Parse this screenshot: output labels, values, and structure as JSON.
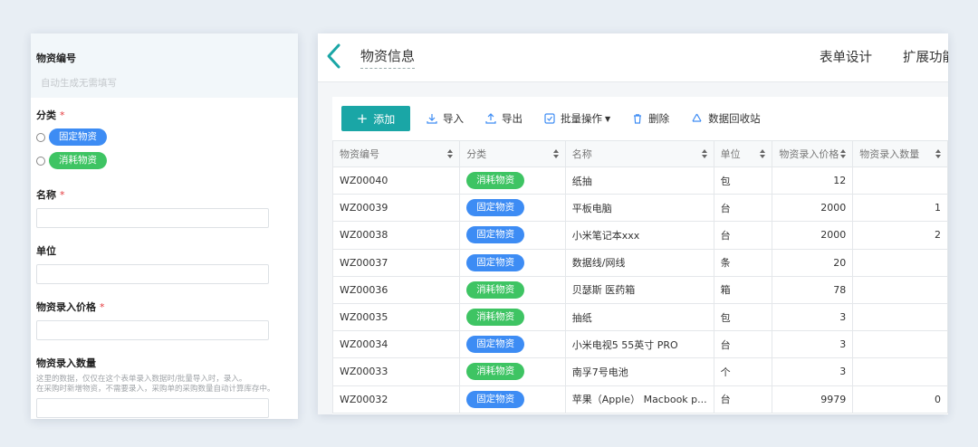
{
  "form": {
    "code_label": "物资编号",
    "code_placeholder": "自动生成无需填写",
    "category_label": "分类",
    "required_mark": "*",
    "category_options": [
      "固定物资",
      "消耗物资"
    ],
    "name_label": "名称",
    "unit_label": "单位",
    "price_label": "物资录入价格",
    "qty_label": "物资录入数量",
    "qty_hint_1": "这里的数据，仅仅在这个表单录入数据时/批量导入时，录入。",
    "qty_hint_2": "在采购时新增物资，不需要录入，采购单的采购数量自动计算库存中。"
  },
  "header": {
    "title": "物资信息",
    "action_design": "表单设计",
    "action_extend": "扩展功能"
  },
  "toolbar": {
    "add": "添加",
    "import": "导入",
    "export": "导出",
    "batch": "批量操作",
    "delete": "删除",
    "recycle": "数据回收站"
  },
  "colors": {
    "accent": "#1aa6a6",
    "fixed": "#3d8cf4",
    "consumable": "#3ec463"
  },
  "table": {
    "columns": [
      "物资编号",
      "分类",
      "名称",
      "单位",
      "物资录入价格",
      "物资录入数量"
    ],
    "rows": [
      {
        "code": "WZ00040",
        "category": "消耗物资",
        "name": "纸抽",
        "unit": "包",
        "price": "12",
        "qty": ""
      },
      {
        "code": "WZ00039",
        "category": "固定物资",
        "name": "平板电脑",
        "unit": "台",
        "price": "2000",
        "qty": "1"
      },
      {
        "code": "WZ00038",
        "category": "固定物资",
        "name": "小米笔记本xxx",
        "unit": "台",
        "price": "2000",
        "qty": "2"
      },
      {
        "code": "WZ00037",
        "category": "固定物资",
        "name": "数据线/网线",
        "unit": "条",
        "price": "20",
        "qty": ""
      },
      {
        "code": "WZ00036",
        "category": "消耗物资",
        "name": "贝瑟斯 医药箱",
        "unit": "箱",
        "price": "78",
        "qty": ""
      },
      {
        "code": "WZ00035",
        "category": "消耗物资",
        "name": "抽纸",
        "unit": "包",
        "price": "3",
        "qty": ""
      },
      {
        "code": "WZ00034",
        "category": "固定物资",
        "name": "小米电视5 55英寸 PRO",
        "unit": "台",
        "price": "3",
        "qty": ""
      },
      {
        "code": "WZ00033",
        "category": "消耗物资",
        "name": "南孚7号电池",
        "unit": "个",
        "price": "3",
        "qty": ""
      },
      {
        "code": "WZ00032",
        "category": "固定物资",
        "name": "苹果（Apple） Macbook p...",
        "unit": "台",
        "price": "9979",
        "qty": "0"
      }
    ]
  }
}
